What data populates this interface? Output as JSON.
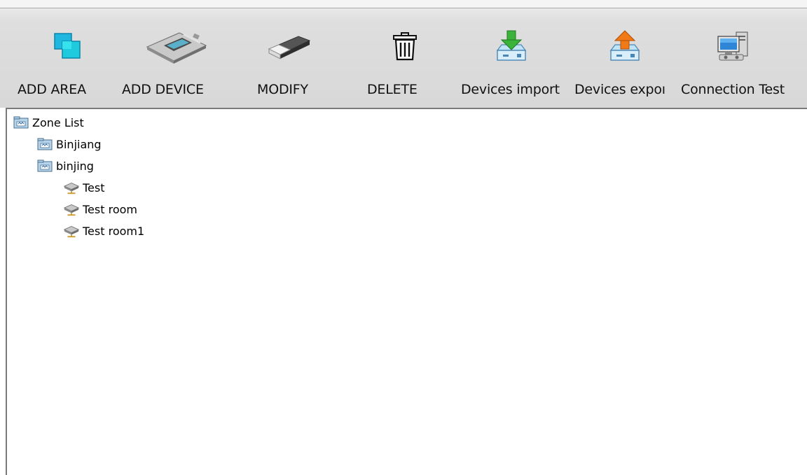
{
  "toolbar": {
    "buttons": [
      {
        "label": "ADD AREA",
        "icon": "add-area-icon"
      },
      {
        "label": "ADD DEVICE",
        "icon": "add-device-icon"
      },
      {
        "label": "MODIFY",
        "icon": "modify-icon"
      },
      {
        "label": "DELETE",
        "icon": "trash-icon"
      },
      {
        "label": "Devices import",
        "icon": "import-icon"
      },
      {
        "label": "Devices expoı",
        "icon": "export-icon"
      },
      {
        "label": "Connection  Test",
        "icon": "connection-test-icon"
      }
    ]
  },
  "tree": {
    "root": {
      "label": "Zone List",
      "icon": "zone-folder-icon"
    },
    "areas": [
      {
        "label": "Binjiang",
        "icon": "zone-folder-icon"
      },
      {
        "label": "binjing",
        "icon": "zone-folder-icon"
      }
    ],
    "devices": [
      {
        "label": "Test",
        "icon": "network-device-icon"
      },
      {
        "label": "Test room",
        "icon": "network-device-icon"
      },
      {
        "label": "Test room1",
        "icon": "network-device-icon"
      }
    ]
  },
  "colors": {
    "toolbar_bg": "#dcdcdc",
    "add_area": "#19b8d8",
    "import_arrow": "#3bb33b",
    "export_arrow": "#f07a18"
  }
}
